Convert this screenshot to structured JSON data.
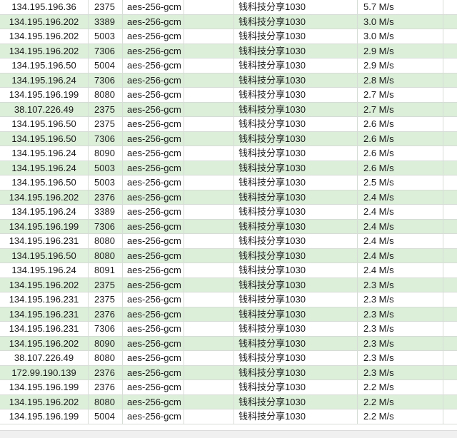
{
  "table": {
    "rows": [
      {
        "ip": "134.195.196.36",
        "port": "2375",
        "cipher": "aes-256-gcm",
        "remark": "钱科技分享1030",
        "speed": "5.7 M/s"
      },
      {
        "ip": "134.195.196.202",
        "port": "3389",
        "cipher": "aes-256-gcm",
        "remark": "钱科技分享1030",
        "speed": "3.0 M/s"
      },
      {
        "ip": "134.195.196.202",
        "port": "5003",
        "cipher": "aes-256-gcm",
        "remark": "钱科技分享1030",
        "speed": "3.0 M/s"
      },
      {
        "ip": "134.195.196.202",
        "port": "7306",
        "cipher": "aes-256-gcm",
        "remark": "钱科技分享1030",
        "speed": "2.9 M/s"
      },
      {
        "ip": "134.195.196.50",
        "port": "5004",
        "cipher": "aes-256-gcm",
        "remark": "钱科技分享1030",
        "speed": "2.9 M/s"
      },
      {
        "ip": "134.195.196.24",
        "port": "7306",
        "cipher": "aes-256-gcm",
        "remark": "钱科技分享1030",
        "speed": "2.8 M/s"
      },
      {
        "ip": "134.195.196.199",
        "port": "8080",
        "cipher": "aes-256-gcm",
        "remark": "钱科技分享1030",
        "speed": "2.7 M/s"
      },
      {
        "ip": "38.107.226.49",
        "port": "2375",
        "cipher": "aes-256-gcm",
        "remark": "钱科技分享1030",
        "speed": "2.7 M/s"
      },
      {
        "ip": "134.195.196.50",
        "port": "2375",
        "cipher": "aes-256-gcm",
        "remark": "钱科技分享1030",
        "speed": "2.6 M/s"
      },
      {
        "ip": "134.195.196.50",
        "port": "7306",
        "cipher": "aes-256-gcm",
        "remark": "钱科技分享1030",
        "speed": "2.6 M/s"
      },
      {
        "ip": "134.195.196.24",
        "port": "8090",
        "cipher": "aes-256-gcm",
        "remark": "钱科技分享1030",
        "speed": "2.6 M/s"
      },
      {
        "ip": "134.195.196.24",
        "port": "5003",
        "cipher": "aes-256-gcm",
        "remark": "钱科技分享1030",
        "speed": "2.6 M/s"
      },
      {
        "ip": "134.195.196.50",
        "port": "5003",
        "cipher": "aes-256-gcm",
        "remark": "钱科技分享1030",
        "speed": "2.5 M/s"
      },
      {
        "ip": "134.195.196.202",
        "port": "2376",
        "cipher": "aes-256-gcm",
        "remark": "钱科技分享1030",
        "speed": "2.4 M/s"
      },
      {
        "ip": "134.195.196.24",
        "port": "3389",
        "cipher": "aes-256-gcm",
        "remark": "钱科技分享1030",
        "speed": "2.4 M/s"
      },
      {
        "ip": "134.195.196.199",
        "port": "7306",
        "cipher": "aes-256-gcm",
        "remark": "钱科技分享1030",
        "speed": "2.4 M/s"
      },
      {
        "ip": "134.195.196.231",
        "port": "8080",
        "cipher": "aes-256-gcm",
        "remark": "钱科技分享1030",
        "speed": "2.4 M/s"
      },
      {
        "ip": "134.195.196.50",
        "port": "8080",
        "cipher": "aes-256-gcm",
        "remark": "钱科技分享1030",
        "speed": "2.4 M/s"
      },
      {
        "ip": "134.195.196.24",
        "port": "8091",
        "cipher": "aes-256-gcm",
        "remark": "钱科技分享1030",
        "speed": "2.4 M/s"
      },
      {
        "ip": "134.195.196.202",
        "port": "2375",
        "cipher": "aes-256-gcm",
        "remark": "钱科技分享1030",
        "speed": "2.3 M/s"
      },
      {
        "ip": "134.195.196.231",
        "port": "2375",
        "cipher": "aes-256-gcm",
        "remark": "钱科技分享1030",
        "speed": "2.3 M/s"
      },
      {
        "ip": "134.195.196.231",
        "port": "2376",
        "cipher": "aes-256-gcm",
        "remark": "钱科技分享1030",
        "speed": "2.3 M/s"
      },
      {
        "ip": "134.195.196.231",
        "port": "7306",
        "cipher": "aes-256-gcm",
        "remark": "钱科技分享1030",
        "speed": "2.3 M/s"
      },
      {
        "ip": "134.195.196.202",
        "port": "8090",
        "cipher": "aes-256-gcm",
        "remark": "钱科技分享1030",
        "speed": "2.3 M/s"
      },
      {
        "ip": "38.107.226.49",
        "port": "8080",
        "cipher": "aes-256-gcm",
        "remark": "钱科技分享1030",
        "speed": "2.3 M/s"
      },
      {
        "ip": "172.99.190.139",
        "port": "2376",
        "cipher": "aes-256-gcm",
        "remark": "钱科技分享1030",
        "speed": "2.3 M/s"
      },
      {
        "ip": "134.195.196.199",
        "port": "2376",
        "cipher": "aes-256-gcm",
        "remark": "钱科技分享1030",
        "speed": "2.2 M/s"
      },
      {
        "ip": "134.195.196.202",
        "port": "8080",
        "cipher": "aes-256-gcm",
        "remark": "钱科技分享1030",
        "speed": "2.2 M/s"
      },
      {
        "ip": "134.195.196.199",
        "port": "5004",
        "cipher": "aes-256-gcm",
        "remark": "钱科技分享1030",
        "speed": "2.2 M/s"
      }
    ]
  },
  "colors": {
    "row_alt": "#dcefd9",
    "row_plain": "#ffffff",
    "grid_line": "#d6dcd6"
  },
  "scrollbar": {
    "horizontal_position": 0
  }
}
